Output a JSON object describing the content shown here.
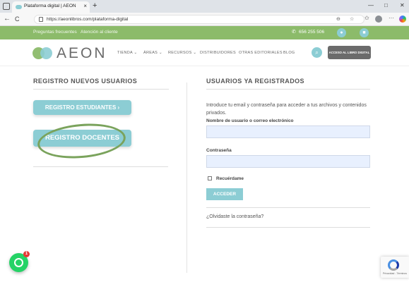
{
  "browser": {
    "tab_title": "Plataforma digital | AEON",
    "tab_close": "×",
    "new_tab": "+",
    "url": "https://aeonlibros.com/plataforma-digital",
    "window_controls": [
      "—",
      "□",
      "✕"
    ],
    "nav": {
      "back": "←",
      "refresh": "C"
    },
    "icons": [
      "reader-icon",
      "favorite-star-icon",
      "favorites-icon",
      "extensions-icon",
      "more-icon",
      "copilot-icon"
    ]
  },
  "topbar": {
    "links": [
      "Preguntas frecuentes",
      "Atención al cliente"
    ],
    "phone": "656 255 506",
    "bg_color": "#8cbb6a"
  },
  "header": {
    "logo_text": "AEON",
    "nav": [
      {
        "label": "TIENDA",
        "has_dropdown": true
      },
      {
        "label": "ÁREAS",
        "has_dropdown": true
      },
      {
        "label": "RECURSOS",
        "has_dropdown": true
      },
      {
        "label": "DISTRIBUIDORES",
        "has_dropdown": false
      },
      {
        "label": "OTRAS EDITORIALES",
        "has_dropdown": false
      },
      {
        "label": "BLOG",
        "has_dropdown": false
      }
    ],
    "dropdown_chevron": "⌄",
    "access_button": "ACCESO AL LIBRO DIGITAL",
    "accent_color": "#8ccdd4"
  },
  "left": {
    "title": "REGISTRO NUEVOS USUARIOS",
    "btn_students": "REGISTRO ESTUDIANTES  ›",
    "btn_teachers": "REGISTRO DOCENTES"
  },
  "right": {
    "title": "USUARIOS YA REGISTRADOS",
    "intro": "Introduce tu email y contraseña para acceder a tus archivos y contenidos privados.",
    "username_label": "Nombre de usuario o correo electrónico",
    "password_label": "Contraseña",
    "remember_label": "Recuérdame",
    "submit": "ACCEDER",
    "forgot": "¿Olvidaste la contraseña?"
  },
  "floating": {
    "whatsapp_badge": "1",
    "recaptcha_text": "Privacidad - Términos"
  }
}
